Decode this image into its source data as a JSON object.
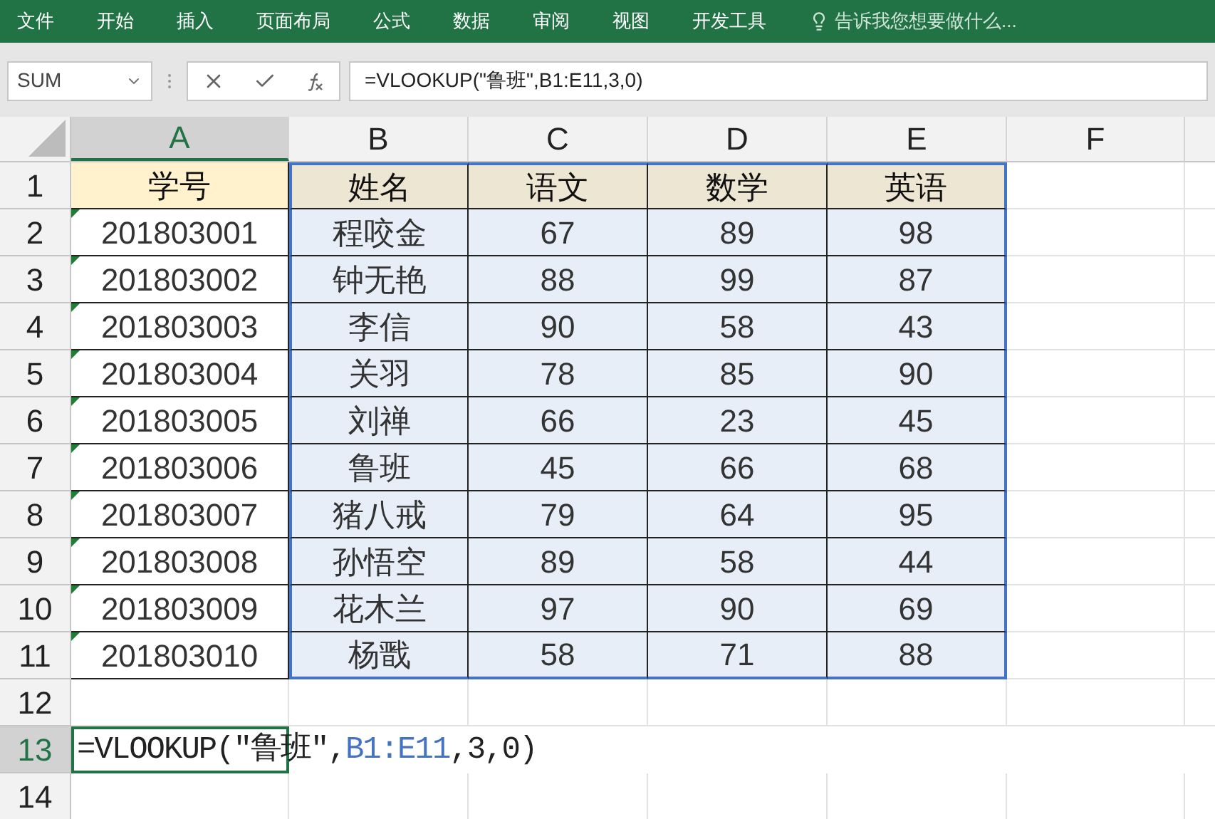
{
  "ribbon": {
    "tabs": [
      {
        "label": "文件",
        "selected": false
      },
      {
        "label": "开始",
        "selected": false
      },
      {
        "label": "插入",
        "selected": false
      },
      {
        "label": "页面布局",
        "selected": false
      },
      {
        "label": "公式",
        "selected": false
      },
      {
        "label": "数据",
        "selected": false
      },
      {
        "label": "审阅",
        "selected": false
      },
      {
        "label": "视图",
        "selected": false
      },
      {
        "label": "开发工具",
        "selected": false
      }
    ],
    "tell_me": "告诉我您想要做什么..."
  },
  "formula_bar": {
    "name_box": "SUM",
    "formula": "=VLOOKUP(\"鲁班\",B1:E11,3,0)"
  },
  "sheet": {
    "columns": [
      {
        "label": "A",
        "selected": true
      },
      {
        "label": "B",
        "selected": false
      },
      {
        "label": "C",
        "selected": false
      },
      {
        "label": "D",
        "selected": false
      },
      {
        "label": "E",
        "selected": false
      },
      {
        "label": "F",
        "selected": false
      }
    ],
    "rows": [
      {
        "label": "1",
        "selected": false,
        "cells": [
          {
            "text": "学号"
          },
          {
            "text": "姓名"
          },
          {
            "text": "语文"
          },
          {
            "text": "数学"
          },
          {
            "text": "英语"
          }
        ]
      },
      {
        "label": "2",
        "selected": false,
        "cells": [
          {
            "text": "201803001",
            "flag": true
          },
          {
            "text": "程咬金"
          },
          {
            "text": "67"
          },
          {
            "text": "89"
          },
          {
            "text": "98"
          }
        ]
      },
      {
        "label": "3",
        "selected": false,
        "cells": [
          {
            "text": "201803002",
            "flag": true
          },
          {
            "text": "钟无艳"
          },
          {
            "text": "88"
          },
          {
            "text": "99"
          },
          {
            "text": "87"
          }
        ]
      },
      {
        "label": "4",
        "selected": false,
        "cells": [
          {
            "text": "201803003",
            "flag": true
          },
          {
            "text": "李信"
          },
          {
            "text": "90"
          },
          {
            "text": "58"
          },
          {
            "text": "43"
          }
        ]
      },
      {
        "label": "5",
        "selected": false,
        "cells": [
          {
            "text": "201803004",
            "flag": true
          },
          {
            "text": "关羽"
          },
          {
            "text": "78"
          },
          {
            "text": "85"
          },
          {
            "text": "90"
          }
        ]
      },
      {
        "label": "6",
        "selected": false,
        "cells": [
          {
            "text": "201803005",
            "flag": true
          },
          {
            "text": "刘禅"
          },
          {
            "text": "66"
          },
          {
            "text": "23"
          },
          {
            "text": "45"
          }
        ]
      },
      {
        "label": "7",
        "selected": false,
        "cells": [
          {
            "text": "201803006",
            "flag": true
          },
          {
            "text": "鲁班"
          },
          {
            "text": "45"
          },
          {
            "text": "66"
          },
          {
            "text": "68"
          }
        ]
      },
      {
        "label": "8",
        "selected": false,
        "cells": [
          {
            "text": "201803007",
            "flag": true
          },
          {
            "text": "猪八戒"
          },
          {
            "text": "79"
          },
          {
            "text": "64"
          },
          {
            "text": "95"
          }
        ]
      },
      {
        "label": "9",
        "selected": false,
        "cells": [
          {
            "text": "201803008",
            "flag": true
          },
          {
            "text": "孙悟空"
          },
          {
            "text": "89"
          },
          {
            "text": "58"
          },
          {
            "text": "44"
          }
        ]
      },
      {
        "label": "10",
        "selected": false,
        "cells": [
          {
            "text": "201803009",
            "flag": true
          },
          {
            "text": "花木兰"
          },
          {
            "text": "97"
          },
          {
            "text": "90"
          },
          {
            "text": "69"
          }
        ]
      },
      {
        "label": "11",
        "selected": false,
        "cells": [
          {
            "text": "201803010",
            "flag": true
          },
          {
            "text": "杨戬"
          },
          {
            "text": "58"
          },
          {
            "text": "71"
          },
          {
            "text": "88"
          }
        ]
      },
      {
        "label": "12",
        "selected": false,
        "cells": []
      },
      {
        "label": "13",
        "selected": true,
        "editing": [
          {
            "kind": "plain",
            "text": "=VLOOKUP(″鲁班″,"
          },
          {
            "kind": "reference",
            "text": "B1:E11"
          },
          {
            "kind": "plain",
            "text": ",3,0)"
          }
        ]
      },
      {
        "label": "14",
        "selected": false,
        "cells": []
      }
    ]
  }
}
